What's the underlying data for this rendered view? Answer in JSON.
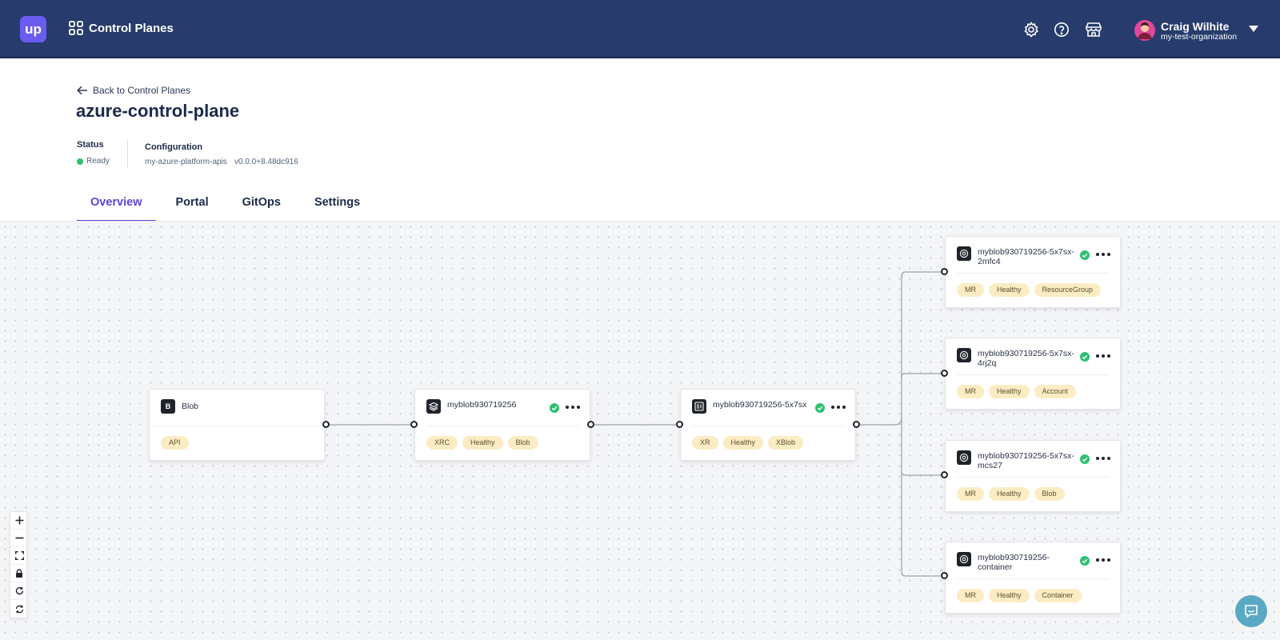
{
  "header": {
    "logo_text": "up",
    "app_title": "Control Planes",
    "user_name": "Craig Wilhite",
    "user_org": "my-test-organization",
    "accent_color": "#273c6c"
  },
  "page": {
    "back_label": "Back to Control Planes",
    "title": "azure-control-plane",
    "status_label": "Status",
    "status_value": "Ready",
    "config_label": "Configuration",
    "config_name": "my-azure-platform-apis",
    "config_version": "v0.0.0+8.48dc916"
  },
  "tabs": [
    {
      "label": "Overview",
      "active": true
    },
    {
      "label": "Portal",
      "active": false
    },
    {
      "label": "GitOps",
      "active": false
    },
    {
      "label": "Settings",
      "active": false
    }
  ],
  "graph": {
    "nodes": [
      {
        "name": "Blob",
        "icon": "blob-letter-icon",
        "icon_text": "B",
        "healthy_icon": false,
        "badges": [
          "API"
        ]
      },
      {
        "name": "myblob930719256",
        "icon": "layers-icon",
        "healthy_icon": true,
        "badges": [
          "XRC",
          "Healthy",
          "Blob"
        ]
      },
      {
        "name": "myblob930719256-5x7sx",
        "icon": "list-icon",
        "healthy_icon": true,
        "badges": [
          "XR",
          "Healthy",
          "XBlob"
        ]
      },
      {
        "name": "myblob930719256-5x7sx-2mfc4",
        "icon": "target-icon",
        "healthy_icon": true,
        "badges": [
          "MR",
          "Healthy",
          "ResourceGroup"
        ]
      },
      {
        "name": "myblob930719256-5x7sx-4rj2q",
        "icon": "target-icon",
        "healthy_icon": true,
        "badges": [
          "MR",
          "Healthy",
          "Account"
        ]
      },
      {
        "name": "myblob930719256-5x7sx-mcs27",
        "icon": "target-icon",
        "healthy_icon": true,
        "badges": [
          "MR",
          "Healthy",
          "Blob"
        ]
      },
      {
        "name": "myblob930719256-container",
        "icon": "target-icon",
        "healthy_icon": true,
        "badges": [
          "MR",
          "Healthy",
          "Container"
        ]
      }
    ],
    "badge_color": "#fbecc3",
    "healthy_color": "#2fbf71"
  },
  "canvas_controls": [
    "zoom-in",
    "zoom-out",
    "fit-view",
    "lock",
    "refresh",
    "sync"
  ]
}
